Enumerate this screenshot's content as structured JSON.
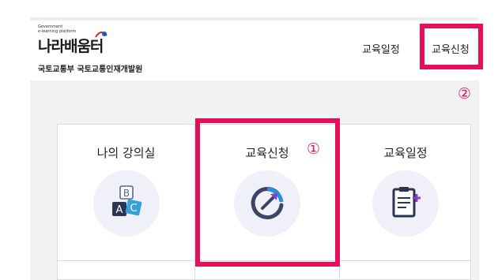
{
  "header": {
    "logo": {
      "small_line1": "Government",
      "small_line2": "e-learning platform",
      "name": "나라배움터"
    },
    "ministry": "국토교통부 국토교통인재개발원",
    "nav": {
      "schedule": "교육일정",
      "apply": "교육신청"
    }
  },
  "annotations": {
    "marker_1": "①",
    "marker_2": "②",
    "highlight_color": "#e5105a"
  },
  "cards": [
    {
      "title": "나의 강의실",
      "icon": "blocks-ab-icon"
    },
    {
      "title": "교육신청",
      "icon": "gauge-arrow-icon"
    },
    {
      "title": "교육일정",
      "icon": "clipboard-plus-icon"
    }
  ]
}
